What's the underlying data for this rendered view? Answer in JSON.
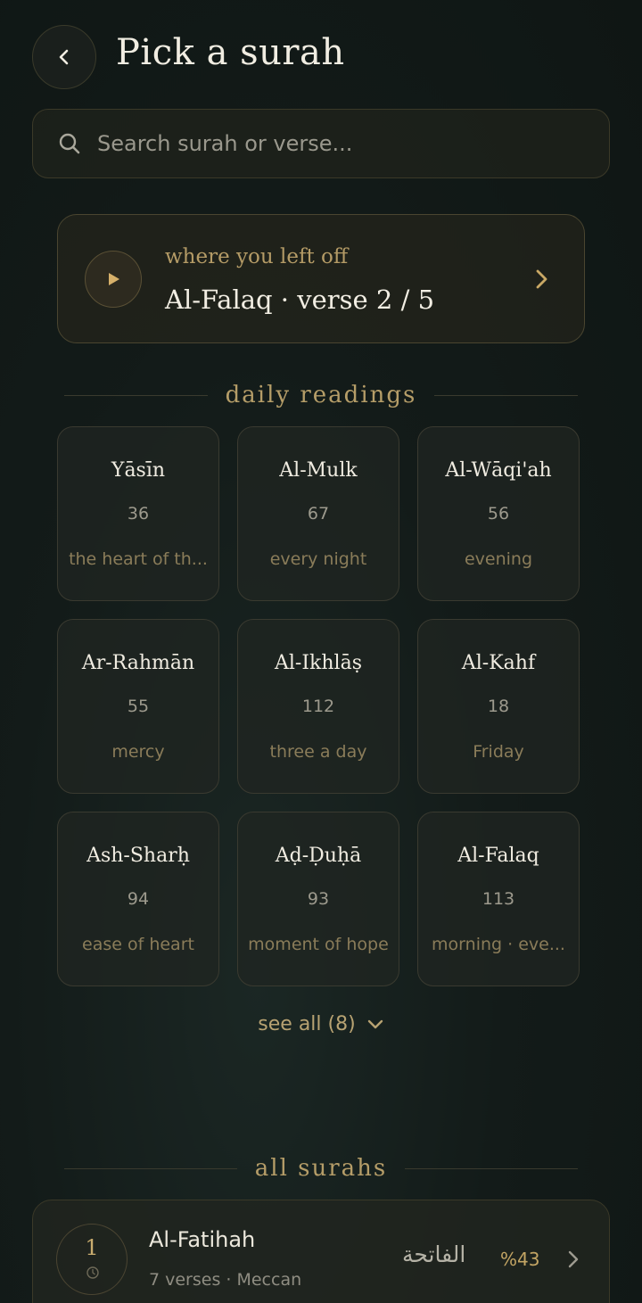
{
  "header": {
    "title": "Pick a surah"
  },
  "search": {
    "placeholder": "Search surah or verse..."
  },
  "resume": {
    "caption": "where you left off",
    "title": "Al-Falaq · verse 2 / 5"
  },
  "daily": {
    "heading": "daily readings",
    "items": [
      {
        "name": "Yāsīn",
        "number": "36",
        "note": "the heart of th..."
      },
      {
        "name": "Al-Mulk",
        "number": "67",
        "note": "every night"
      },
      {
        "name": "Al-Wāqi'ah",
        "number": "56",
        "note": "evening"
      },
      {
        "name": "Ar-Rahmān",
        "number": "55",
        "note": "mercy"
      },
      {
        "name": "Al-Ikhlāṣ",
        "number": "112",
        "note": "three a day"
      },
      {
        "name": "Al-Kahf",
        "number": "18",
        "note": "Friday"
      },
      {
        "name": "Ash-Sharḥ",
        "number": "94",
        "note": "ease of heart"
      },
      {
        "name": "Aḍ-Ḍuḥā",
        "number": "93",
        "note": "moment of hope"
      },
      {
        "name": "Al-Falaq",
        "number": "113",
        "note": "morning · eve..."
      }
    ],
    "see_all": "see all (8)"
  },
  "all_surahs": {
    "heading": "all surahs",
    "items": [
      {
        "number": "1",
        "name": "Al-Fatihah",
        "meta": "7 verses · Meccan",
        "arabic": "الفاتحة",
        "progress": "%43"
      }
    ]
  },
  "colors": {
    "accent": "#b59d68",
    "background": "#131b19"
  }
}
